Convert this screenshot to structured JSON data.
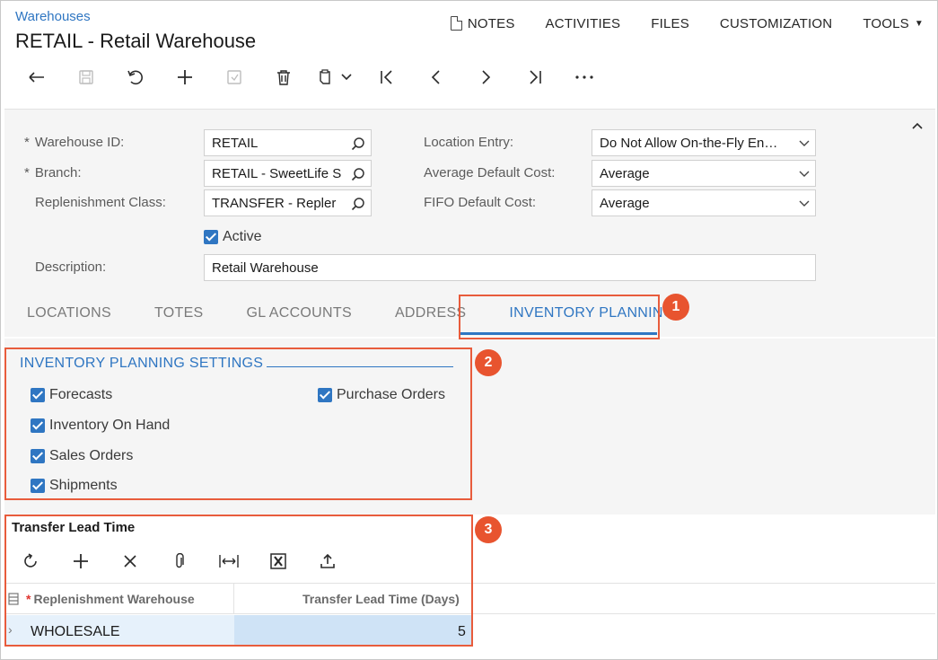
{
  "header": {
    "breadcrumb": "Warehouses",
    "title": "RETAIL - Retail Warehouse"
  },
  "top_menu": {
    "notes": "NOTES",
    "activities": "ACTIVITIES",
    "files": "FILES",
    "customization": "CUSTOMIZATION",
    "tools": "TOOLS"
  },
  "toolbar": {
    "buttons": [
      "back-icon",
      "save-icon",
      "undo-icon",
      "add-icon",
      "copy-paste-icon",
      "delete-icon",
      "clipboard-icon",
      "first-icon",
      "prev-icon",
      "next-icon",
      "last-icon",
      "more-icon"
    ]
  },
  "form": {
    "warehouse_id_label": "Warehouse ID:",
    "warehouse_id_value": "RETAIL",
    "branch_label": "Branch:",
    "branch_value": "RETAIL - SweetLife S",
    "replenishment_class_label": "Replenishment Class:",
    "replenishment_class_value": "TRANSFER - Repler",
    "active_label": "Active",
    "active_checked": true,
    "description_label": "Description:",
    "description_value": "Retail Warehouse",
    "location_entry_label": "Location Entry:",
    "location_entry_value": "Do Not Allow On-the-Fly En…",
    "avg_default_cost_label": "Average Default Cost:",
    "avg_default_cost_value": "Average",
    "fifo_default_cost_label": "FIFO Default Cost:",
    "fifo_default_cost_value": "Average"
  },
  "tabs": [
    {
      "label": "LOCATIONS",
      "active": false
    },
    {
      "label": "TOTES",
      "active": false
    },
    {
      "label": "GL ACCOUNTS",
      "active": false
    },
    {
      "label": "ADDRESS",
      "active": false
    },
    {
      "label": "INVENTORY PLANNING",
      "active": true
    }
  ],
  "planning": {
    "section_title": "INVENTORY PLANNING SETTINGS",
    "checkboxes": {
      "forecasts": "Forecasts",
      "inventory_on_hand": "Inventory On Hand",
      "sales_orders": "Sales Orders",
      "shipments": "Shipments",
      "purchase_orders": "Purchase Orders"
    }
  },
  "transfer_grid": {
    "title": "Transfer Lead Time",
    "columns": [
      "Replenishment Warehouse",
      "Transfer Lead Time (Days)"
    ],
    "rows": [
      {
        "warehouse": "WHOLESALE",
        "lead_time": "5"
      }
    ]
  },
  "callouts": {
    "one": "1",
    "two": "2",
    "three": "3"
  },
  "colors": {
    "accent": "#2f76c2",
    "callout": "#e8542f"
  }
}
